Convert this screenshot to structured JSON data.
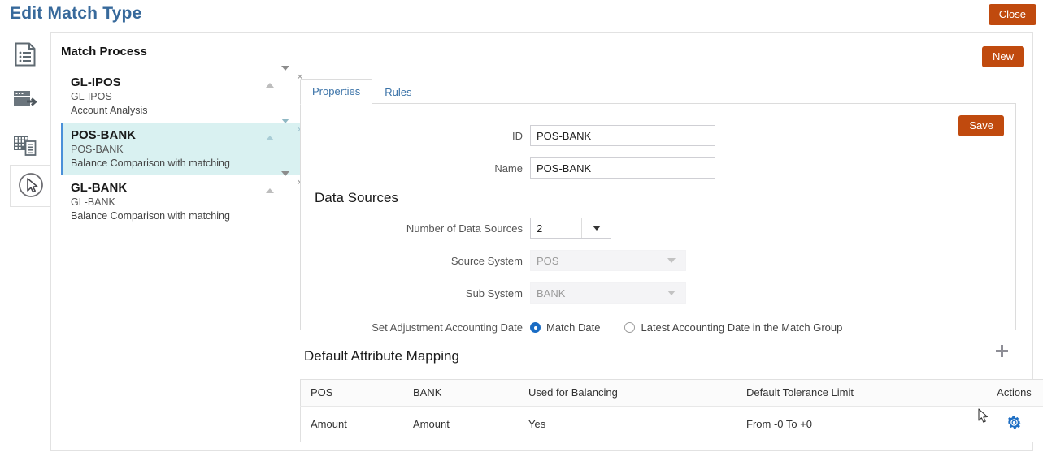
{
  "page": {
    "title": "Edit Match Type",
    "title_color": "#37699b",
    "accent_orange": "#c04a0e",
    "selected_highlight": "#d9f1f1",
    "selected_border": "#4a90d9",
    "gear_blue": "#1f6fc4"
  },
  "buttons": {
    "close": "Close",
    "new": "New",
    "save": "Save"
  },
  "icon_rail": {
    "items": [
      {
        "name": "document-list-icon"
      },
      {
        "name": "data-load-icon"
      },
      {
        "name": "grid-report-icon"
      },
      {
        "name": "cursor-pointer-icon"
      }
    ]
  },
  "match_process": {
    "header": "Match Process",
    "items": [
      {
        "title": "GL-IPOS",
        "subtitle": "GL-IPOS",
        "description": "Account Analysis",
        "selected": false
      },
      {
        "title": "POS-BANK",
        "subtitle": "POS-BANK",
        "description": "Balance Comparison with matching",
        "selected": true
      },
      {
        "title": "GL-BANK",
        "subtitle": "GL-BANK",
        "description": "Balance Comparison with matching",
        "selected": false
      }
    ],
    "row_tools": {
      "move_up": "move-up",
      "move_down": "move-down",
      "remove": "×"
    }
  },
  "tabs": [
    {
      "label": "Properties",
      "active": true
    },
    {
      "label": "Rules",
      "active": false
    }
  ],
  "properties": {
    "id": {
      "label": "ID",
      "value": "POS-BANK"
    },
    "name": {
      "label": "Name",
      "value": "POS-BANK"
    },
    "data_sources": {
      "section_title": "Data Sources",
      "number": {
        "label": "Number of Data Sources",
        "value": "2",
        "enabled": true
      },
      "source_system": {
        "label": "Source System",
        "value": "POS",
        "enabled": false
      },
      "sub_system": {
        "label": "Sub System",
        "value": "BANK",
        "enabled": false
      }
    },
    "adjustment_date": {
      "label": "Set Adjustment Accounting Date",
      "options": [
        {
          "label": "Match Date",
          "selected": true
        },
        {
          "label": "Latest Accounting Date in the Match Group",
          "selected": false
        }
      ]
    }
  },
  "mapping": {
    "title": "Default Attribute Mapping",
    "add_label": "add-row",
    "columns": [
      "POS",
      "BANK",
      "Used for Balancing",
      "Default Tolerance Limit",
      "Actions"
    ],
    "rows": [
      {
        "pos": "Amount",
        "bank": "Amount",
        "used_for_balancing": "Yes",
        "default_tolerance_limit": "From -0 To +0",
        "action_icon": "gear-icon"
      }
    ]
  }
}
